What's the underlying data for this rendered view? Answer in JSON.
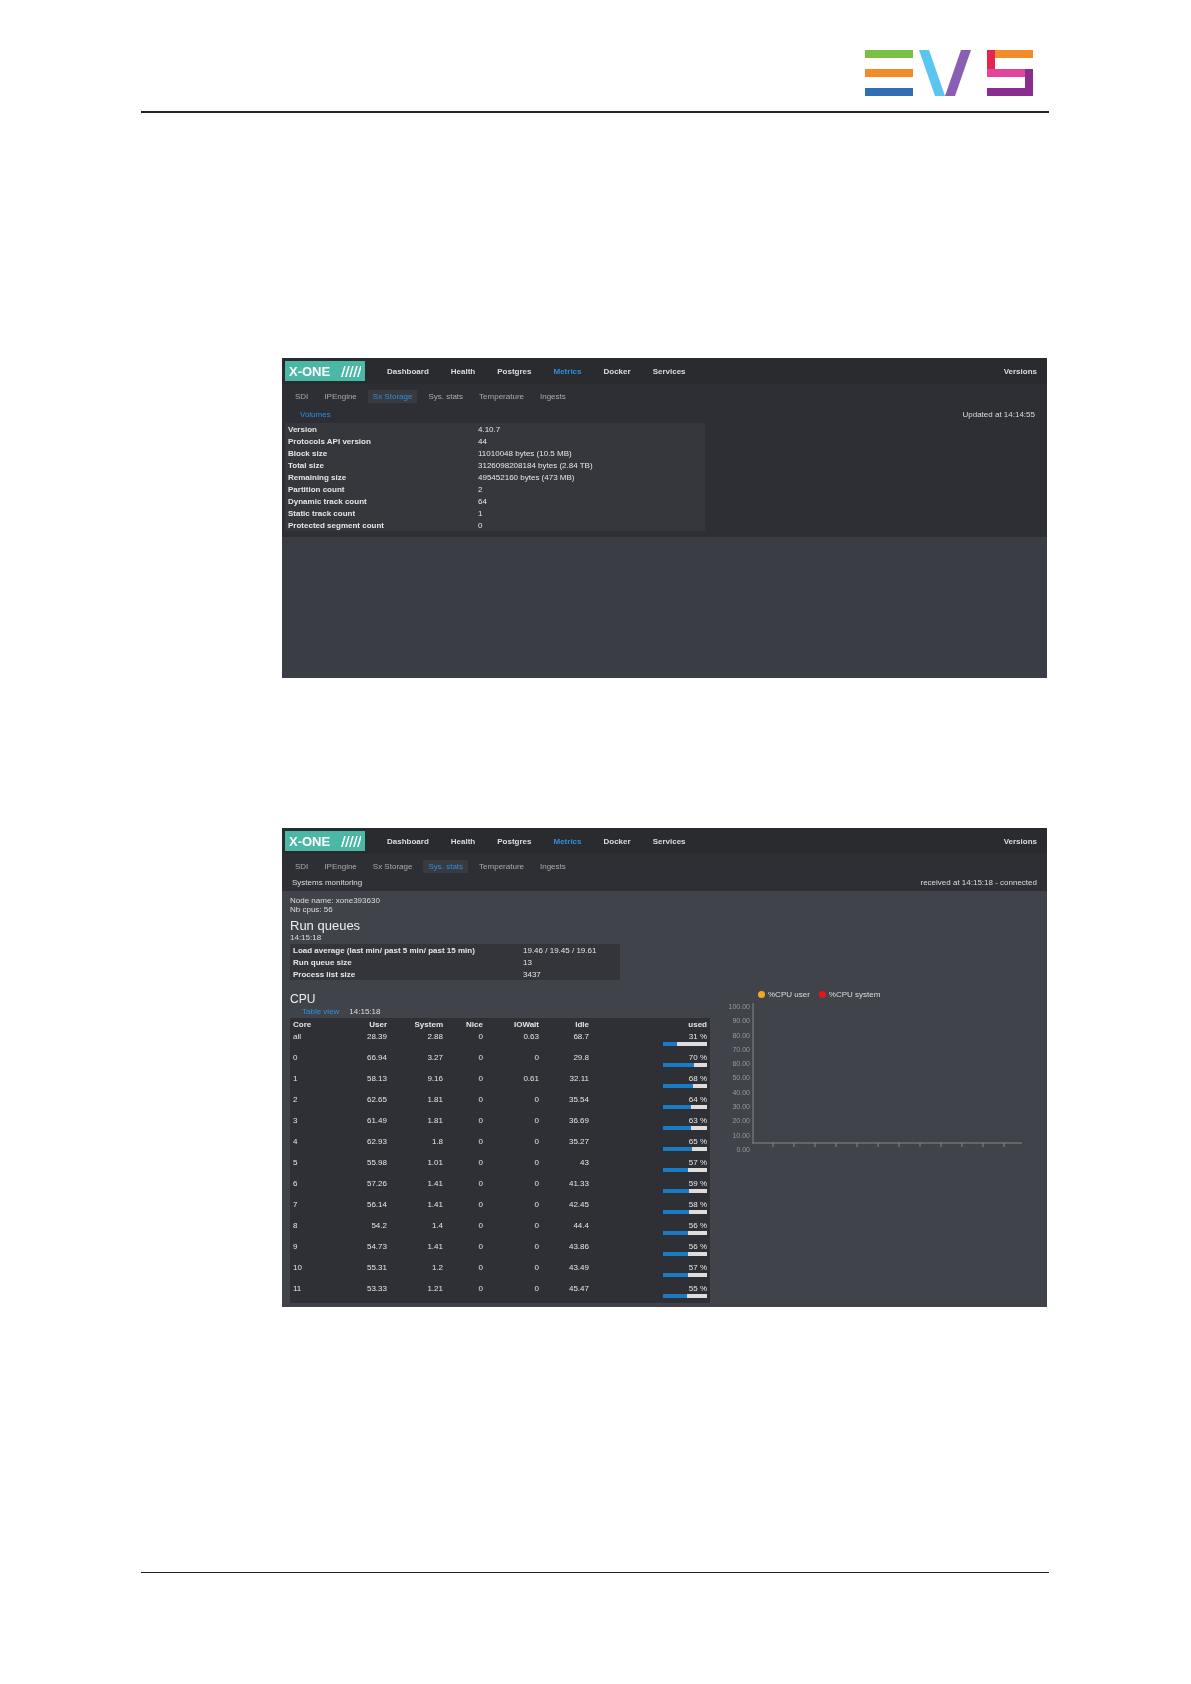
{
  "screenshots": [
    {
      "kind": "storage",
      "brand": "X-ONE",
      "nav_items": [
        {
          "label": "Dashboard",
          "selected": false
        },
        {
          "label": "Health",
          "selected": false
        },
        {
          "label": "Postgres",
          "selected": false
        },
        {
          "label": "Metrics",
          "selected": true
        },
        {
          "label": "Docker",
          "selected": false
        },
        {
          "label": "Services",
          "selected": false
        }
      ],
      "versions": "Versions",
      "tabs": [
        {
          "label": "SDI",
          "selected": false
        },
        {
          "label": "IPEngine",
          "selected": false
        },
        {
          "label": "Sx Storage",
          "selected": true
        },
        {
          "label": "Sys. stats",
          "selected": false
        },
        {
          "label": "Temperature",
          "selected": false
        },
        {
          "label": "Ingests",
          "selected": false
        }
      ],
      "sub_link": "Volumes",
      "updated": "Updated at 14:14:55",
      "rows": [
        {
          "label": "Version",
          "value": "4.10.7"
        },
        {
          "label": "Protocols API version",
          "value": "44"
        },
        {
          "label": "Block size",
          "value": "11010048 bytes (10.5 MB)"
        },
        {
          "label": "Total size",
          "value": "3126098208184 bytes (2.84 TB)"
        },
        {
          "label": "Remaining size",
          "value": "495452160 bytes (473 MB)"
        },
        {
          "label": "Partition count",
          "value": "2"
        },
        {
          "label": "Dynamic track count",
          "value": "64"
        },
        {
          "label": "Static track count",
          "value": "1"
        },
        {
          "label": "Protected segment count",
          "value": "0"
        }
      ]
    },
    {
      "kind": "stats",
      "brand": "X-ONE",
      "nav_items": [
        {
          "label": "Dashboard",
          "selected": false
        },
        {
          "label": "Health",
          "selected": false
        },
        {
          "label": "Postgres",
          "selected": false
        },
        {
          "label": "Metrics",
          "selected": true
        },
        {
          "label": "Docker",
          "selected": false
        },
        {
          "label": "Services",
          "selected": false
        }
      ],
      "versions": "Versions",
      "tabs": [
        {
          "label": "SDI",
          "selected": false
        },
        {
          "label": "IPEngine",
          "selected": false
        },
        {
          "label": "Sx Storage",
          "selected": false
        },
        {
          "label": "Sys. stats",
          "selected": true
        },
        {
          "label": "Temperature",
          "selected": false
        },
        {
          "label": "Ingests",
          "selected": false
        }
      ],
      "section_title": "Systems monitoring",
      "received": "received at 14:15:18 - connected",
      "node_name": "Node name: xone393630",
      "nb_cpus": "Nb cpus: 56",
      "run_queues": {
        "title": "Run queues",
        "time": "14:15:18",
        "rows": [
          {
            "label": "Load average (last min/ past 5 min/ past 15 min)",
            "value": "19.46 / 19.45 / 19.61"
          },
          {
            "label": "Run queue size",
            "value": "13"
          },
          {
            "label": "Process list size",
            "value": "3437"
          }
        ]
      },
      "cpu": {
        "title": "CPU",
        "link": "Table view",
        "time": "14:15:18",
        "columns": [
          "Core",
          "User",
          "System",
          "Nice",
          "IOWait",
          "Idle",
          "used"
        ],
        "rows": [
          {
            "cells": [
              "all",
              "28.39",
              "2.88",
              "0",
              "0.63",
              "68.7"
            ],
            "used": "31 %",
            "level": 0.31
          },
          {
            "cells": [
              "0",
              "66.94",
              "3.27",
              "0",
              "0",
              "29.8"
            ],
            "used": "70 %",
            "level": 0.7
          },
          {
            "cells": [
              "1",
              "58.13",
              "9.16",
              "0",
              "0.61",
              "32.11"
            ],
            "used": "68 %",
            "level": 0.68
          },
          {
            "cells": [
              "2",
              "62.65",
              "1.81",
              "0",
              "0",
              "35.54"
            ],
            "used": "64 %",
            "level": 0.64
          },
          {
            "cells": [
              "3",
              "61.49",
              "1.81",
              "0",
              "0",
              "36.69"
            ],
            "used": "63 %",
            "level": 0.63
          },
          {
            "cells": [
              "4",
              "62.93",
              "1.8",
              "0",
              "0",
              "35.27"
            ],
            "used": "65 %",
            "level": 0.65
          },
          {
            "cells": [
              "5",
              "55.98",
              "1.01",
              "0",
              "0",
              "43"
            ],
            "used": "57 %",
            "level": 0.57
          },
          {
            "cells": [
              "6",
              "57.26",
              "1.41",
              "0",
              "0",
              "41.33"
            ],
            "used": "59 %",
            "level": 0.59
          },
          {
            "cells": [
              "7",
              "56.14",
              "1.41",
              "0",
              "0",
              "42.45"
            ],
            "used": "58 %",
            "level": 0.58
          },
          {
            "cells": [
              "8",
              "54.2",
              "1.4",
              "0",
              "0",
              "44.4"
            ],
            "used": "56 %",
            "level": 0.56
          },
          {
            "cells": [
              "9",
              "54.73",
              "1.41",
              "0",
              "0",
              "43.86"
            ],
            "used": "56 %",
            "level": 0.56
          },
          {
            "cells": [
              "10",
              "55.31",
              "1.2",
              "0",
              "0",
              "43.49"
            ],
            "used": "57 %",
            "level": 0.57
          },
          {
            "cells": [
              "11",
              "53.33",
              "1.21",
              "0",
              "0",
              "45.47"
            ],
            "used": "55 %",
            "level": 0.55
          }
        ]
      },
      "chart": {
        "legend": [
          {
            "label": "%CPU user",
            "color": "#f5a623"
          },
          {
            "label": "%CPU system",
            "color": "#e8141c"
          }
        ],
        "y_axis_labels": [
          "100.00",
          "90.00",
          "80.00",
          "70.00",
          "60.00",
          "50.00",
          "40.00",
          "30.00",
          "20.00",
          "10.00",
          "0.00"
        ]
      }
    }
  ]
}
